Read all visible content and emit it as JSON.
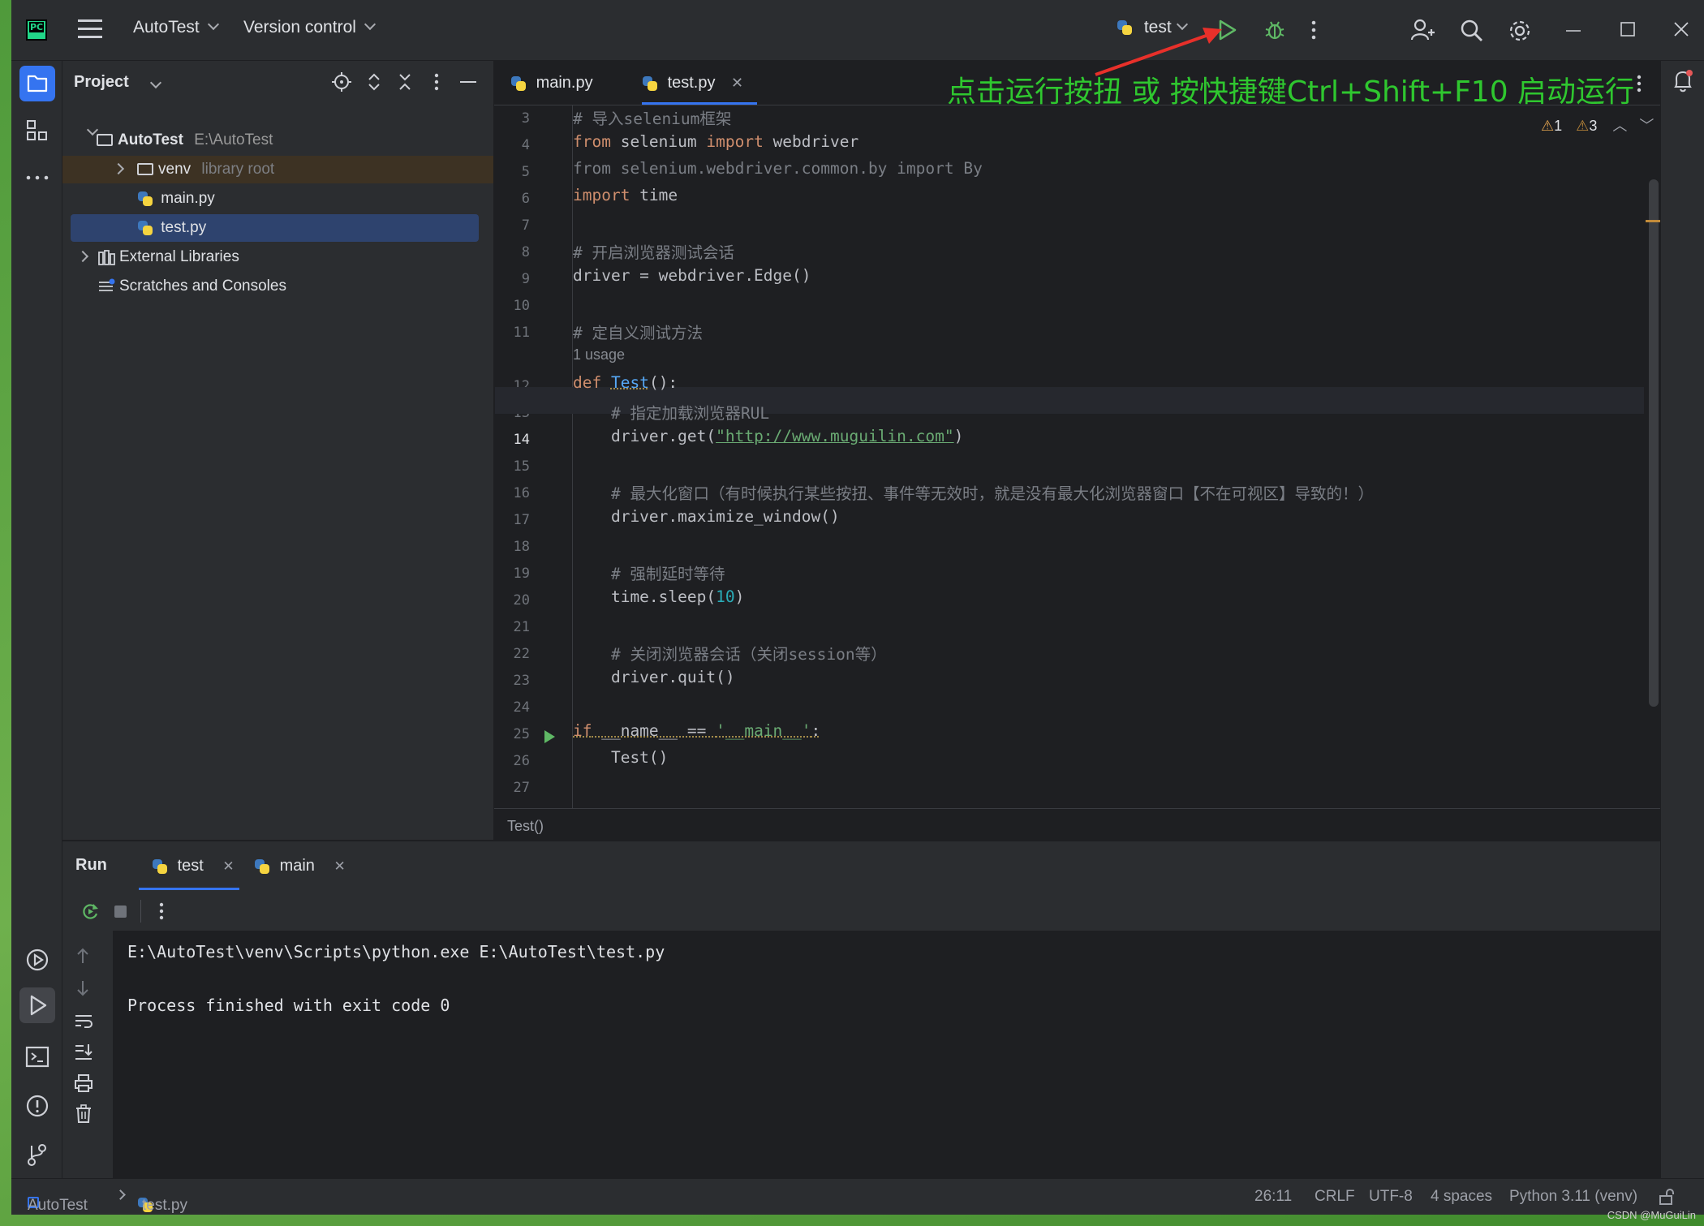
{
  "titlebar": {
    "project_name": "AutoTest",
    "vcs": "Version control",
    "run_config": "test"
  },
  "project_panel": {
    "title": "Project",
    "tree": [
      {
        "label": "AutoTest",
        "extra": "E:\\AutoTest"
      },
      {
        "label": "venv",
        "extra": "library root"
      },
      {
        "label": "main.py",
        "extra": ""
      },
      {
        "label": "test.py",
        "extra": ""
      },
      {
        "label": "External Libraries",
        "extra": ""
      },
      {
        "label": "Scratches and Consoles",
        "extra": ""
      }
    ]
  },
  "editor": {
    "tabs": [
      {
        "label": "main.py"
      },
      {
        "label": "test.py"
      }
    ],
    "warnings": {
      "w1": "1",
      "w2": "3"
    },
    "breadcrumb": "Test()",
    "line_numbers": [
      "3",
      "4",
      "5",
      "6",
      "7",
      "8",
      "9",
      "10",
      "11",
      "",
      "12",
      "13",
      "14",
      "15",
      "16",
      "17",
      "18",
      "19",
      "20",
      "21",
      "22",
      "23",
      "24",
      "25",
      "26",
      "27"
    ],
    "usage_hint": "1 usage",
    "code": {
      "l3": "# 导入selenium框架",
      "l4_kw1": "from",
      "l4_a": " selenium ",
      "l4_kw2": "import",
      "l4_b": " webdriver",
      "l5": "from selenium.webdriver.common.by import By",
      "l6_kw": "import",
      "l6_a": " time",
      "l8": "# 开启浏览器测试会话",
      "l9": "driver = webdriver.Edge()",
      "l11": "# 定自义测试方法",
      "l12_kw": "def",
      "l12_fn": "Test",
      "l12_rest": "():",
      "l13": "    # 指定加载浏览器RUL",
      "l14_a": "    driver.get(",
      "l14_str": "\"http://www.muguilin.com\"",
      "l14_b": ")",
      "l16": "    # 最大化窗口（有时候执行某些按扭、事件等无效时，就是没有最大化浏览器窗口【不在可视区】导致的！）",
      "l17": "    driver.maximize_window()",
      "l19": "    # 强制延时等待",
      "l20_a": "    time.sleep(",
      "l20_num": "10",
      "l20_b": ")",
      "l22": "    # 关闭浏览器会话（关闭session等）",
      "l23": "    driver.quit()",
      "l25_kw": "if",
      "l25_a": " __name__ == ",
      "l25_str": "'__main__'",
      "l25_b": ":",
      "l26": "    Test()"
    }
  },
  "annotation": "点击运行按扭 或 按快捷键Ctrl+Shift+F10 启动运行",
  "run_panel": {
    "title": "Run",
    "tabs": [
      {
        "label": "test"
      },
      {
        "label": "main"
      }
    ],
    "console": [
      "E:\\AutoTest\\venv\\Scripts\\python.exe E:\\AutoTest\\test.py",
      "Process finished with exit code 0"
    ]
  },
  "statusbar": {
    "project": "AutoTest",
    "file": "test.py",
    "position": "26:11",
    "line_sep": "CRLF",
    "encoding": "UTF-8",
    "indent": "4 spaces",
    "interpreter": "Python 3.11 (venv)"
  },
  "watermark": "CSDN @MuGuiLin",
  "colors": {
    "accent": "#3574f0",
    "run_green": "#5fb865",
    "annotation": "#2fc72f",
    "arrow": "#e8302a"
  }
}
